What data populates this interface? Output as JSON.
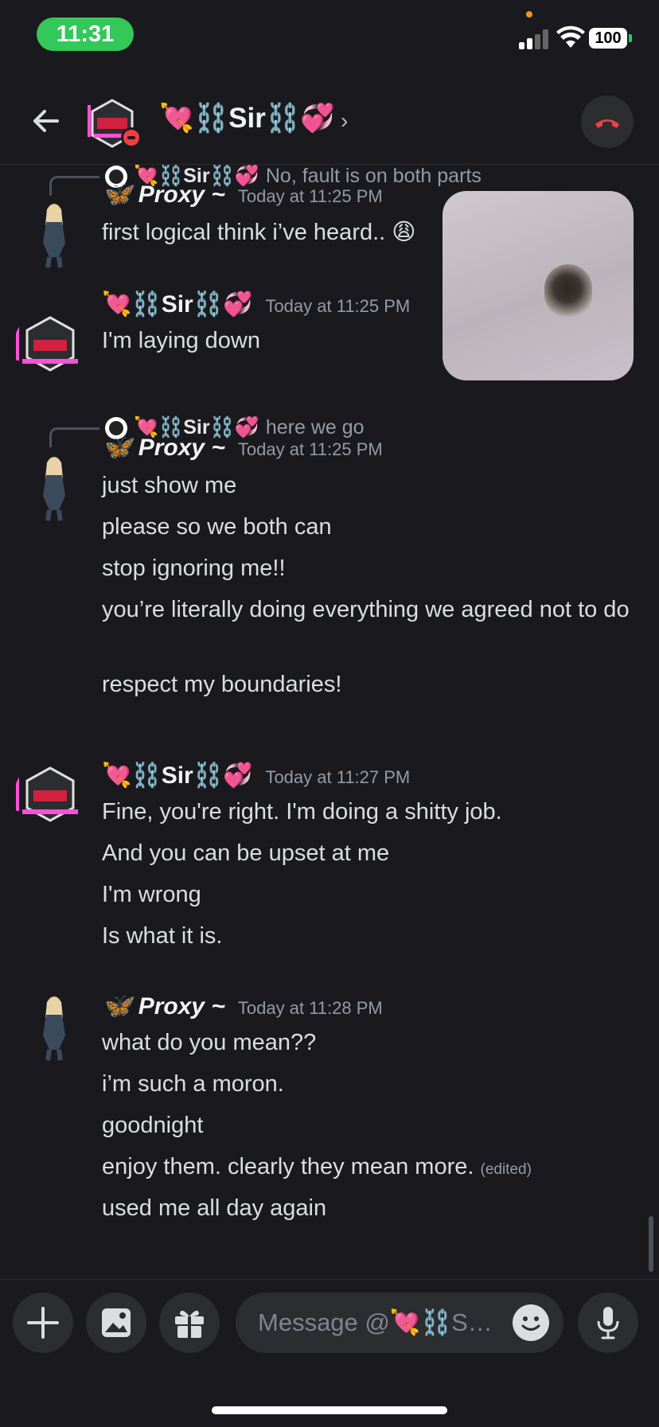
{
  "status": {
    "time": "11:31",
    "battery": "100"
  },
  "header": {
    "name": "💘⛓️Sir⛓️💞",
    "chevron": "›"
  },
  "messages": [
    {
      "reply_name": "💘⛓️Sir⛓️💞",
      "reply_text": "No, fault is on both parts",
      "author": "🦋 Proxy ~",
      "time": "Today at 11:25 PM",
      "lines": [
        "first logical think i’ve heard.. 😩"
      ]
    },
    {
      "author": "💘⛓️Sir⛓️💞",
      "time": "Today at 11:25 PM",
      "lines": [
        "I'm laying down"
      ]
    },
    {
      "reply_name": "💘⛓️Sir⛓️💞",
      "reply_text": "here we go",
      "author": "🦋 Proxy ~",
      "time": "Today at 11:25 PM",
      "lines": [
        "just show me",
        "please so we both can",
        "stop ignoring me!!",
        "you’re literally doing everything we agreed not to do",
        "respect my boundaries!"
      ]
    },
    {
      "author": "💘⛓️Sir⛓️💞",
      "time": "Today at 11:27 PM",
      "lines": [
        "Fine, you're right. I'm doing a shitty job.",
        "And you can be upset at me",
        "I'm wrong",
        "Is what it is."
      ]
    },
    {
      "author": "🦋 Proxy ~",
      "time": "Today at 11:28 PM",
      "lines": [
        "what do you mean??",
        "i’m such a moron.",
        "goodnight",
        "enjoy them. clearly they mean more.",
        "used me all day again"
      ],
      "edited": "(edited)"
    }
  ],
  "composer": {
    "placeholder": "Message @💘⛓️Sir⛓️💞"
  }
}
